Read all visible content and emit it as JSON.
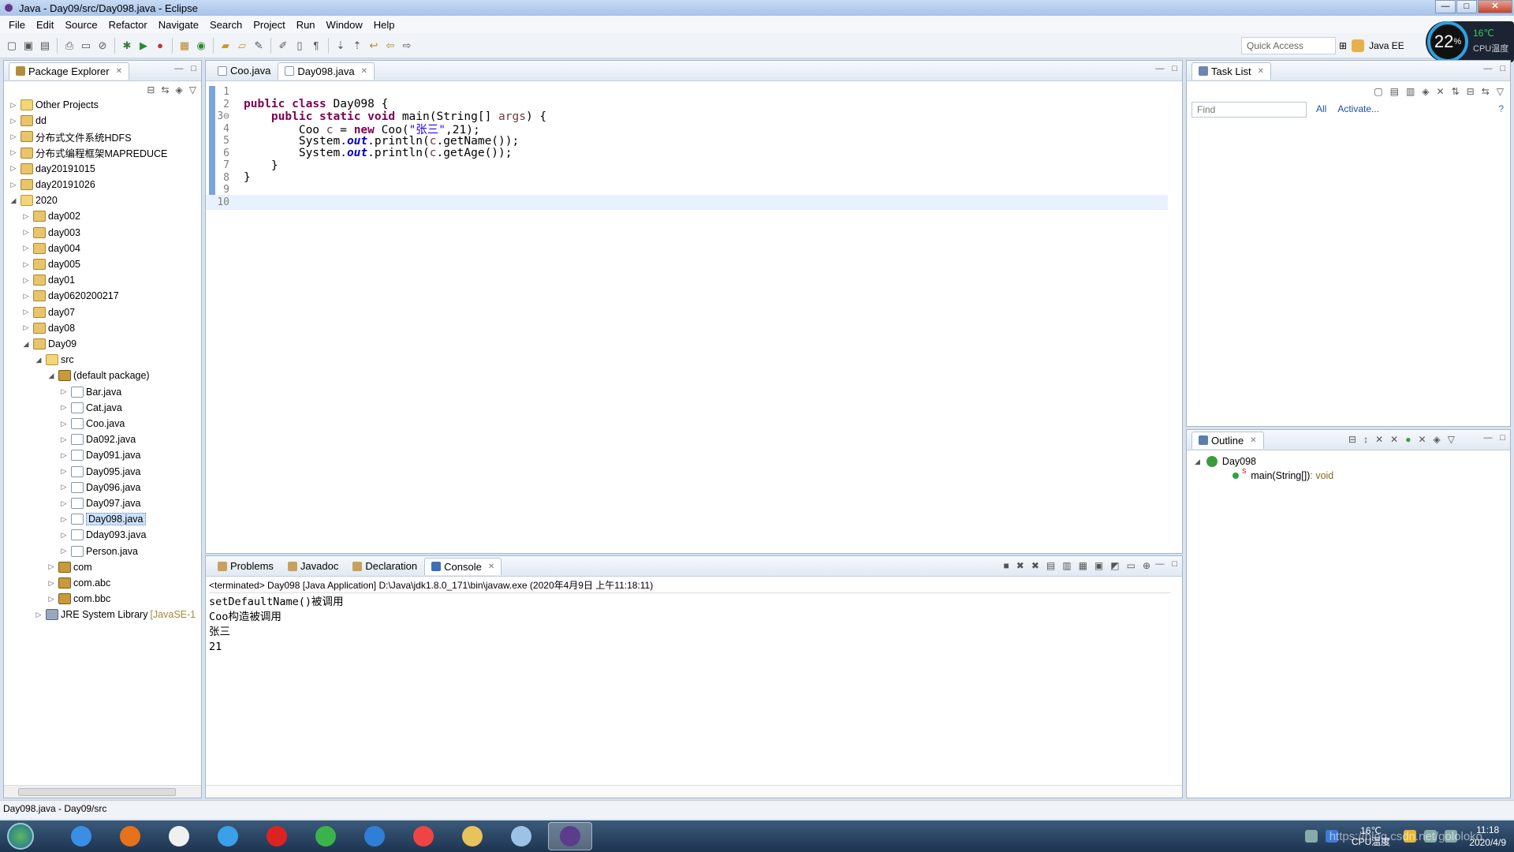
{
  "window": {
    "title": "Java - Day09/src/Day098.java - Eclipse"
  },
  "menu": [
    "File",
    "Edit",
    "Source",
    "Refactor",
    "Navigate",
    "Search",
    "Project",
    "Run",
    "Window",
    "Help"
  ],
  "toolbar": {
    "quick_access_placeholder": "Quick Access",
    "perspective": "Java EE"
  },
  "cpu_widget": {
    "percent": "22",
    "percent_unit": "%",
    "temperature": "16℃",
    "label": "CPU温度"
  },
  "package_explorer": {
    "title": "Package Explorer",
    "tree": [
      {
        "label": "Other Projects",
        "icon": "folder-projects-icon",
        "depth": 0,
        "expanded": false
      },
      {
        "label": "dd",
        "icon": "project-icon",
        "depth": 0,
        "expanded": false
      },
      {
        "label": "分布式文件系统HDFS",
        "icon": "project-icon",
        "depth": 0,
        "expanded": false
      },
      {
        "label": "分布式编程框架MAPREDUCE",
        "icon": "project-icon",
        "depth": 0,
        "expanded": false
      },
      {
        "label": "day20191015",
        "icon": "project-icon",
        "depth": 0,
        "expanded": false
      },
      {
        "label": "day20191026",
        "icon": "project-icon",
        "depth": 0,
        "expanded": false
      },
      {
        "label": "2020",
        "icon": "working-set-icon",
        "depth": 0,
        "expanded": true
      },
      {
        "label": "day002",
        "icon": "project-icon",
        "depth": 1,
        "expanded": false
      },
      {
        "label": "day003",
        "icon": "project-icon",
        "depth": 1,
        "expanded": false
      },
      {
        "label": "day004",
        "icon": "project-icon",
        "depth": 1,
        "expanded": false
      },
      {
        "label": "day005",
        "icon": "project-icon",
        "depth": 1,
        "expanded": false
      },
      {
        "label": "day01",
        "icon": "project-icon",
        "depth": 1,
        "expanded": false
      },
      {
        "label": "day0620200217",
        "icon": "project-icon",
        "depth": 1,
        "expanded": false
      },
      {
        "label": "day07",
        "icon": "project-icon",
        "depth": 1,
        "expanded": false
      },
      {
        "label": "day08",
        "icon": "project-icon",
        "depth": 1,
        "expanded": false
      },
      {
        "label": "Day09",
        "icon": "project-icon",
        "depth": 1,
        "expanded": true
      },
      {
        "label": "src",
        "icon": "source-folder-icon",
        "depth": 2,
        "expanded": true
      },
      {
        "label": "(default package)",
        "icon": "package-icon",
        "depth": 3,
        "expanded": true
      },
      {
        "label": "Bar.java",
        "icon": "java-file-icon",
        "depth": 4,
        "expanded": false
      },
      {
        "label": "Cat.java",
        "icon": "java-file-icon",
        "depth": 4,
        "expanded": false
      },
      {
        "label": "Coo.java",
        "icon": "java-file-icon",
        "depth": 4,
        "expanded": false
      },
      {
        "label": "Da092.java",
        "icon": "java-file-icon",
        "depth": 4,
        "expanded": false
      },
      {
        "label": "Day091.java",
        "icon": "java-file-icon",
        "depth": 4,
        "expanded": false
      },
      {
        "label": "Day095.java",
        "icon": "java-file-icon",
        "depth": 4,
        "expanded": false
      },
      {
        "label": "Day096.java",
        "icon": "java-file-icon",
        "depth": 4,
        "expanded": false
      },
      {
        "label": "Day097.java",
        "icon": "java-file-icon",
        "depth": 4,
        "expanded": false
      },
      {
        "label": "Day098.java",
        "icon": "java-file-icon",
        "depth": 4,
        "expanded": false,
        "selected": true
      },
      {
        "label": "Dday093.java",
        "icon": "java-file-icon",
        "depth": 4,
        "expanded": false
      },
      {
        "label": "Person.java",
        "icon": "java-file-icon",
        "depth": 4,
        "expanded": false
      },
      {
        "label": "com",
        "icon": "package-icon",
        "depth": 3,
        "expanded": false
      },
      {
        "label": "com.abc",
        "icon": "package-icon",
        "depth": 3,
        "expanded": false
      },
      {
        "label": "com.bbc",
        "icon": "package-icon",
        "depth": 3,
        "expanded": false
      },
      {
        "label": "JRE System Library",
        "decoration": "[JavaSE-1",
        "icon": "library-icon",
        "depth": 2,
        "expanded": false
      }
    ]
  },
  "editor": {
    "tabs": [
      {
        "label": "Coo.java",
        "active": false
      },
      {
        "label": "Day098.java",
        "active": true
      }
    ],
    "lines": [
      {
        "n": "1",
        "html": ""
      },
      {
        "n": "2",
        "html": "<span class='kw'>public</span> <span class='kw'>class</span> Day098 {"
      },
      {
        "n": "3⊖",
        "html": "    <span class='kw'>public</span> <span class='kw'>static</span> <span class='kw'>void</span> main(String[] <span class='var'>args</span>) {"
      },
      {
        "n": "4",
        "html": "        Coo <span class='var'>c</span> = <span class='kw'>new</span> Coo(<span class='str'>\"张三\"</span>,21);"
      },
      {
        "n": "5",
        "html": "        System.<span class='fld'>out</span>.println(<span class='var'>c</span>.getName());"
      },
      {
        "n": "6",
        "html": "        System.<span class='fld'>out</span>.println(<span class='var'>c</span>.getAge());"
      },
      {
        "n": "7",
        "html": "    }"
      },
      {
        "n": "8",
        "html": "}"
      },
      {
        "n": "9",
        "html": ""
      },
      {
        "n": "10",
        "html": ""
      }
    ]
  },
  "console": {
    "tabs": [
      "Problems",
      "Javadoc",
      "Declaration",
      "Console"
    ],
    "active_tab": "Console",
    "status": "<terminated> Day098 [Java Application] D:\\Java\\jdk1.8.0_171\\bin\\javaw.exe (2020年4月9日 上午11:18:11)",
    "output": [
      "setDefaultName()被调用",
      "Coo构造被调用",
      "张三",
      "21"
    ]
  },
  "task_list": {
    "title": "Task List",
    "find_placeholder": "Find",
    "filter_all": "All",
    "filter_activate": "Activate..."
  },
  "outline": {
    "title": "Outline",
    "class_name": "Day098",
    "method_name": "main(String[])",
    "method_return": " : void"
  },
  "status_bar": {
    "text": "Day098.java - Day09/src"
  },
  "taskbar": {
    "apps": [
      "ie-icon",
      "firefox-icon",
      "photos-icon",
      "cloud-icon",
      "youdao-icon",
      "360-icon",
      "ie2-icon",
      "chrome-icon",
      "explorer-icon",
      "notepad-icon",
      "eclipse-icon"
    ],
    "tray_temp": "16℃",
    "tray_temp_label": "CPU温度",
    "time": "11:18",
    "date": "2020/4/9",
    "watermark": "https://blog.csdn.net/gololoko"
  }
}
